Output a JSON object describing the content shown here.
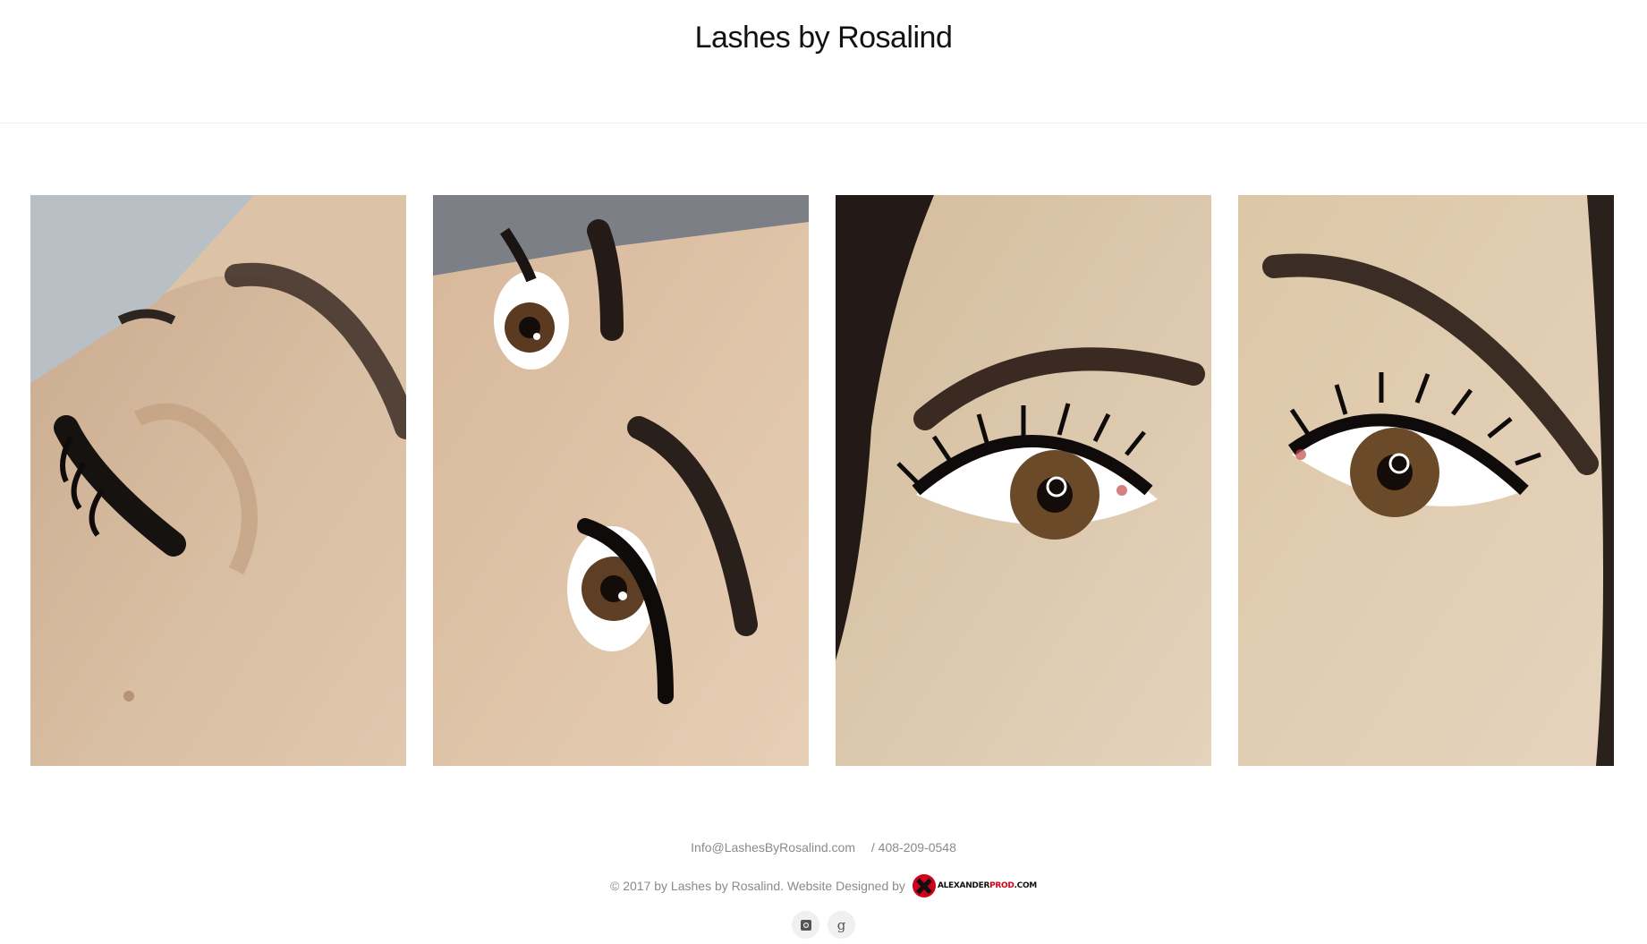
{
  "header": {
    "site_title": "Lashes by Rosalind"
  },
  "gallery": {
    "photos": [
      {
        "alt": "lash-photo-1"
      },
      {
        "alt": "lash-photo-2"
      },
      {
        "alt": "lash-photo-3"
      },
      {
        "alt": "lash-photo-4"
      }
    ]
  },
  "footer": {
    "email": "Info@LashesByRosalind.com",
    "phone_separator": "/",
    "phone": "408-209-0548",
    "copyright": "© 2017 by Lashes by Rosalind. Website Designed by",
    "designer_logo_text_dark": "ALEXANDER",
    "designer_logo_text_accent": "PROD",
    "designer_logo_text_suffix": ".COM",
    "social_icons": [
      "instagram-icon",
      "google-plus-icon"
    ]
  },
  "colors": {
    "text_muted": "#8a8a8a",
    "logo_red": "#d0021b"
  }
}
